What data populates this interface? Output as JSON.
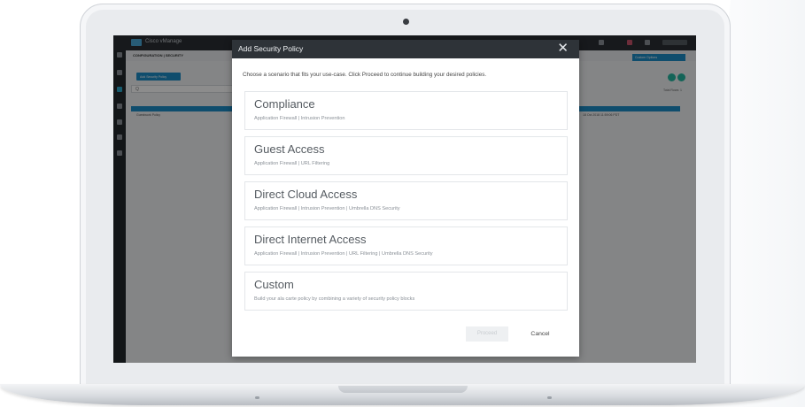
{
  "bg_app": {
    "app_name": "Cisco vManage",
    "breadcrumb": "CONFIGURATION | SECURITY",
    "add_button": "Add Security Policy",
    "search_glyph": "Q",
    "custom_options": "Custom Options",
    "total_rows": "Total Rows: 1",
    "row_name": "Guestwork Policy",
    "row_updated": "18 Oct 2018 11:59:06 PDT"
  },
  "modal": {
    "title": "Add Security Policy",
    "close_glyph": "✕",
    "instructions": "Choose a scenario that fits your use-case. Click Proceed to continue building your desired policies.",
    "scenarios": [
      {
        "title": "Compliance",
        "subtitle": "Application Firewall | Intrusion Prevention"
      },
      {
        "title": "Guest Access",
        "subtitle": "Application Firewall | URL Filtering"
      },
      {
        "title": "Direct Cloud Access",
        "subtitle": "Application Firewall | Intrusion Prevention | Umbrella DNS Security"
      },
      {
        "title": "Direct Internet Access",
        "subtitle": "Application Firewall | Intrusion Prevention | URL Filtering | Umbrella DNS Security"
      },
      {
        "title": "Custom",
        "subtitle": "Build your ala carte policy by combining a variety of security policy blocks"
      }
    ],
    "proceed_label": "Proceed",
    "cancel_label": "Cancel"
  },
  "colors": {
    "header": "#2e3338",
    "accent": "#1d8cc6",
    "teal": "#25b6a0"
  }
}
